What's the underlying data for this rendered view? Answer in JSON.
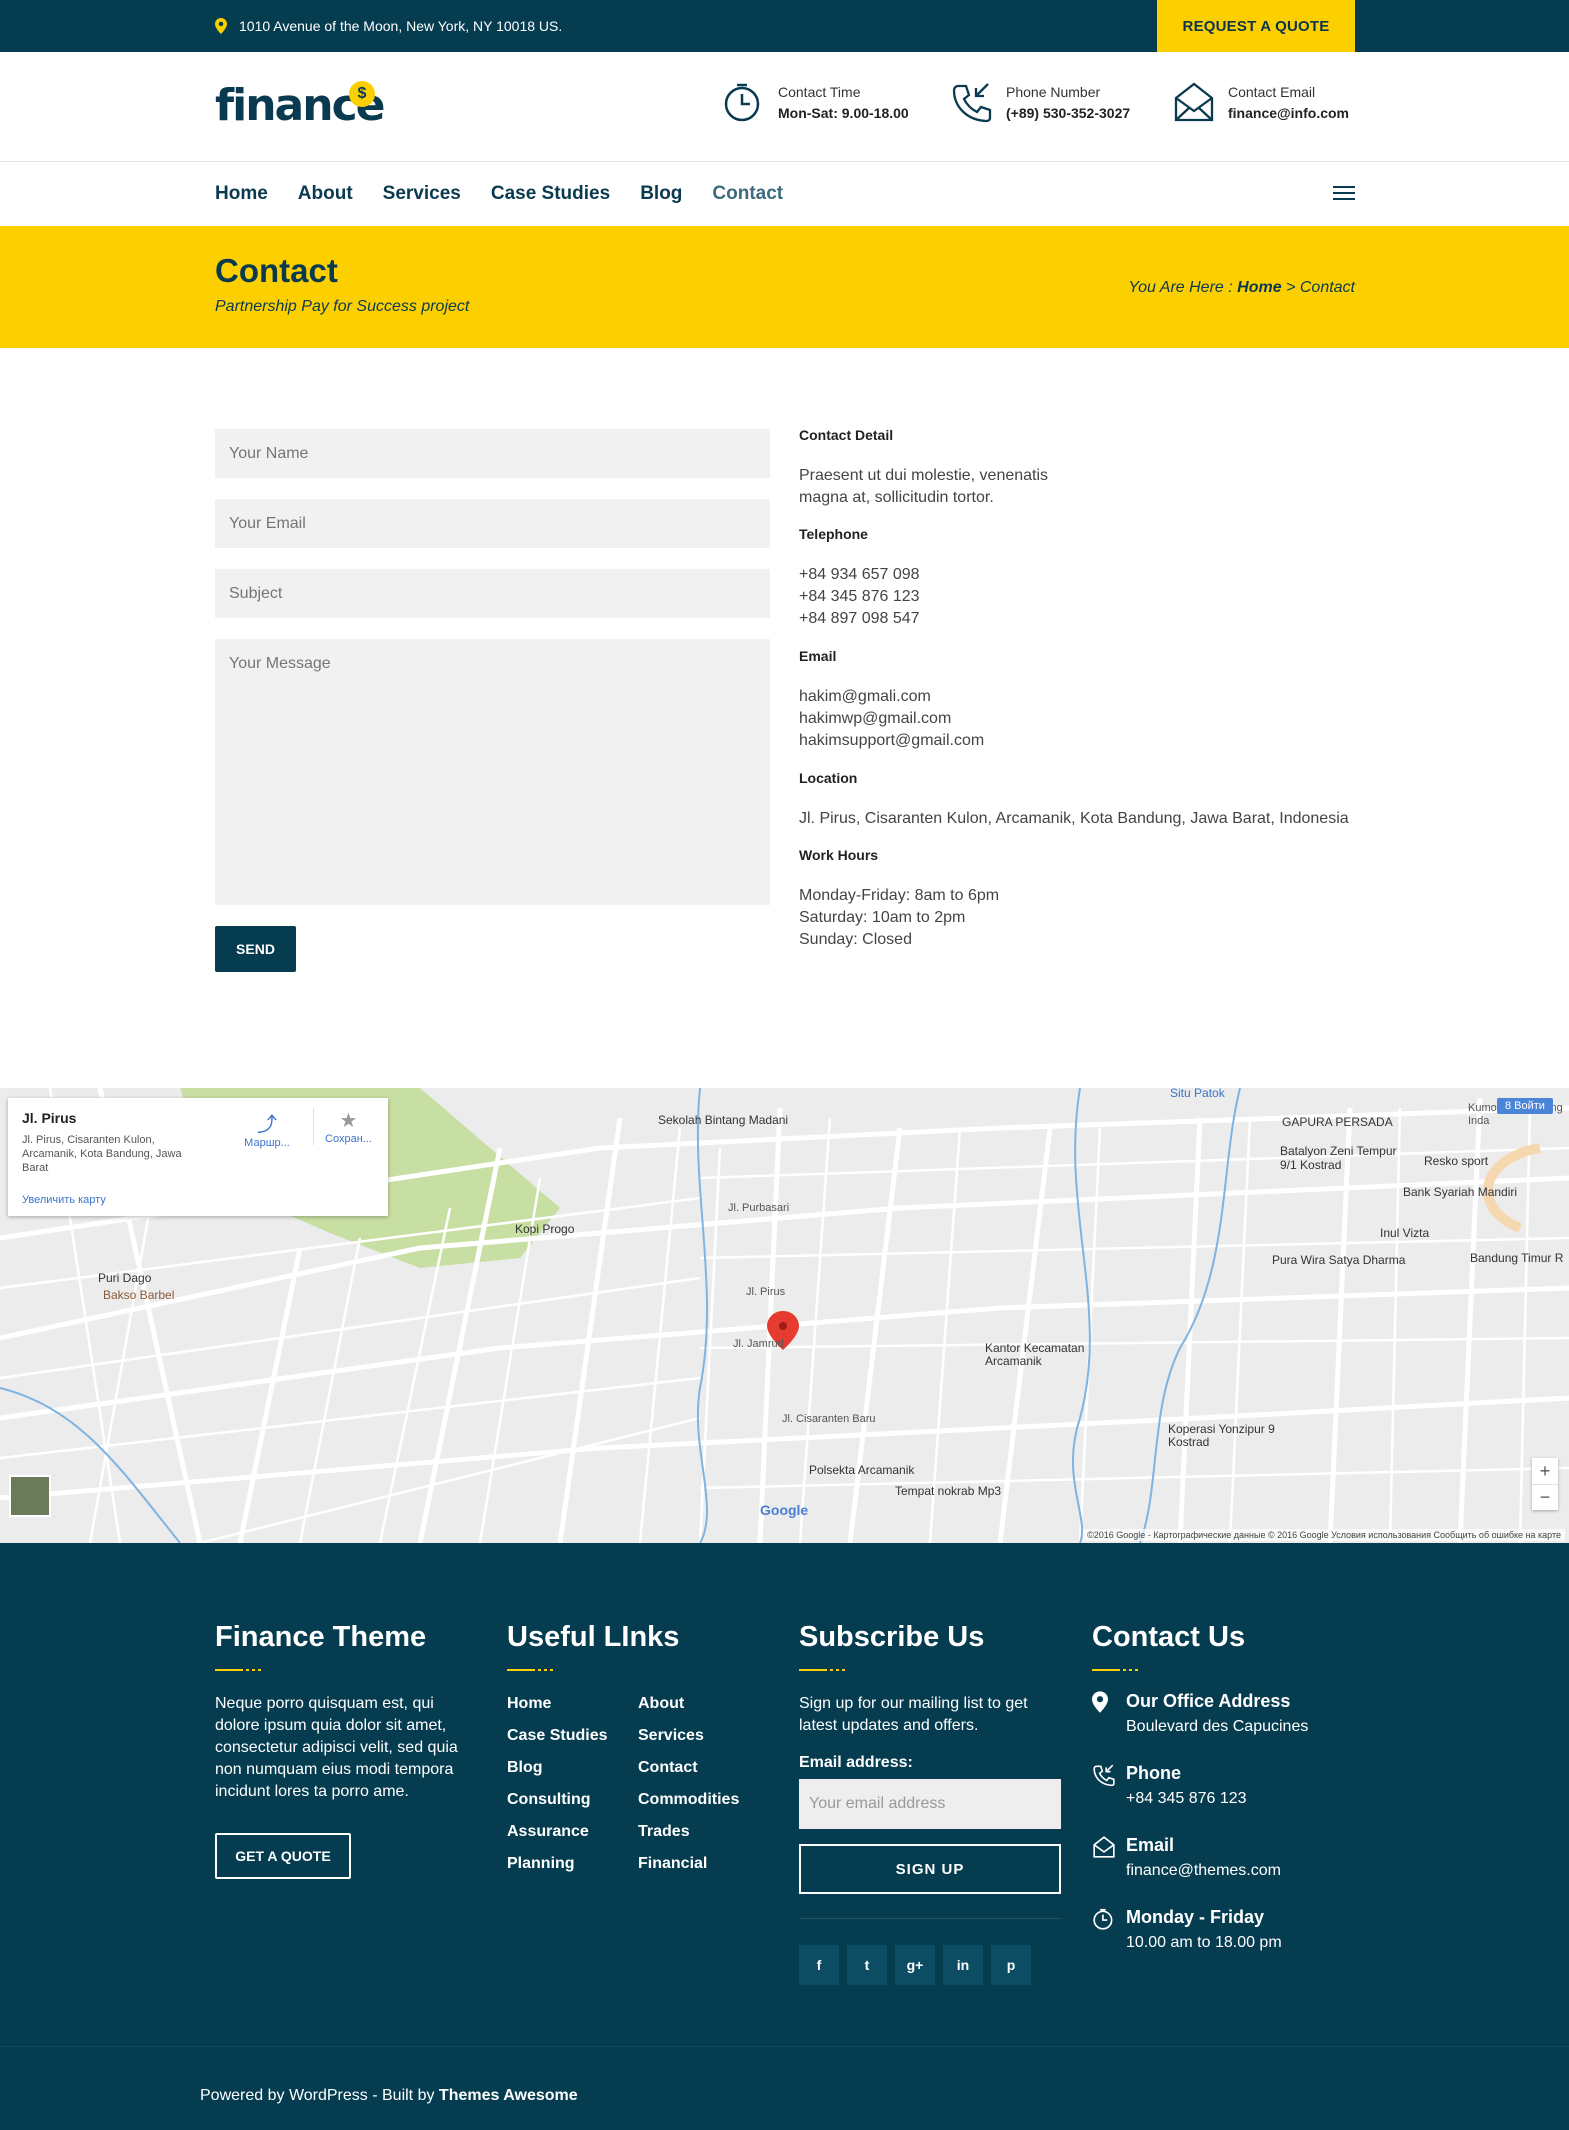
{
  "topbar": {
    "address": "1010 Avenue of the Moon, New York, NY 10018 US.",
    "quote_button": "REQUEST A QUOTE"
  },
  "header": {
    "logo": "finance",
    "logo_badge": "$",
    "info": [
      {
        "label": "Contact Time",
        "value": "Mon-Sat: 9.00-18.00",
        "icon": "clock-icon"
      },
      {
        "label": "Phone Number",
        "value": "(+89) 530-352-3027",
        "icon": "phone-icon"
      },
      {
        "label": "Contact Email",
        "value": "finance@info.com",
        "icon": "envelope-icon"
      }
    ]
  },
  "nav": {
    "items": [
      "Home",
      "About",
      "Services",
      "Case Studies",
      "Blog",
      "Contact"
    ],
    "active": "Contact"
  },
  "banner": {
    "title": "Contact",
    "subtitle": "Partnership Pay for Success project",
    "breadcrumb_prefix": "You Are Here :",
    "breadcrumb_home": "Home",
    "breadcrumb_sep": ">",
    "breadcrumb_current": "Contact"
  },
  "form": {
    "name_placeholder": "Your Name",
    "email_placeholder": "Your Email",
    "subject_placeholder": "Subject",
    "message_placeholder": "Your Message",
    "send_label": "SEND"
  },
  "contact_detail": {
    "heading": "Contact Detail",
    "text_1": "Praesent ut dui molestie, venenatis",
    "text_2": "magna at, sollicitudin tortor.",
    "telephone_heading": "Telephone",
    "phones": [
      "+84 934 657 098",
      "+84 345 876 123",
      "+84 897 098 547"
    ],
    "email_heading": "Email",
    "emails": [
      "hakim@gmali.com",
      "hakimwp@gmail.com",
      "hakimsupport@gmail.com"
    ],
    "location_heading": "Location",
    "location": "Jl. Pirus, Cisaranten Kulon, Arcamanik, Kota Bandung, Jawa Barat, Indonesia",
    "hours_heading": "Work Hours",
    "hours": [
      "Monday-Friday: 8am to 6pm",
      "Saturday: 10am to 2pm",
      "Sunday: Closed"
    ]
  },
  "map": {
    "card_title": "Jl. Pirus",
    "card_address": "Jl. Pirus, Cisaranten Kulon, Arcamanik, Kota Bandung, Jawa Barat",
    "card_zoom_link": "Увеличить карту",
    "card_route": "Маршр...",
    "card_save": "Сохран...",
    "login": "8 Войти",
    "labels": {
      "l1": "Sekolah Bintang Madani",
      "l2": "GAPURA PERSADA",
      "l3": "Batalyon Zeni Tempur 9/1 Kostrad",
      "l4": "Resko sport",
      "l5": "Bank Syariah Mandiri",
      "l6": "Inul Vizta",
      "l7": "Bandung Timur R",
      "l8": "Pura Wira Satya Dharma",
      "l9": "Kopi Progo",
      "l10": "Jl. Purbasari",
      "l11": "Puri Dago",
      "l12": "Bakso Barbel",
      "l13": "Kantor Kecamatan Arcamanik",
      "l14": "Koperasi Yonzipur 9 Kostrad",
      "l15": "Polsekta Arcamanik",
      "l16": "Tempat nokrab Mp3",
      "l17": "Jl. Cisaranten Baru",
      "l18": "Jl. Pirus",
      "l19": "Jl. Jamrud",
      "l20": "Situ Patok",
      "l21": "Kumo Ujungberung Inda"
    },
    "brand": "Google",
    "footer": "©2016 Google - Картографические данные © 2016 Google    Условия использования    Сообщить об ошибке на карте",
    "zoom_in": "+",
    "zoom_out": "−"
  },
  "footer": {
    "about_title": "Finance Theme",
    "about_text": "Neque porro quisquam est, qui dolore ipsum quia dolor sit amet, consectetur adipisci velit, sed quia non numquam eius modi tempora incidunt lores ta porro ame.",
    "quote_button": "GET A QUOTE",
    "links_title": "Useful LInks",
    "links_col1": [
      "Home",
      "Case Studies",
      "Blog",
      "Consulting",
      "Assurance",
      "Planning"
    ],
    "links_col2": [
      "About",
      "Services",
      "Contact",
      "Commodities",
      "Trades",
      "Financial"
    ],
    "subscribe_title": "Subscribe Us",
    "subscribe_text": "Sign up for our mailing list to get latest updates and offers.",
    "email_label": "Email address:",
    "email_placeholder": "Your email address",
    "signup_label": "SIGN UP",
    "social": [
      "f",
      "t",
      "g+",
      "in",
      "p"
    ],
    "contact_title": "Contact Us",
    "contact": [
      {
        "title": "Our Office Address",
        "value": "Boulevard des Capucines"
      },
      {
        "title": "Phone",
        "value": "+84 345 876 123"
      },
      {
        "title": "Email",
        "value": "finance@themes.com"
      },
      {
        "title": "Monday - Friday",
        "value": "10.00 am to 18.00 pm"
      }
    ],
    "copyright_prefix": "Powered by WordPress - Built by",
    "copyright_brand": "Themes Awesome"
  },
  "colors": {
    "navy": "#053c50",
    "yellow": "#fccf00"
  }
}
